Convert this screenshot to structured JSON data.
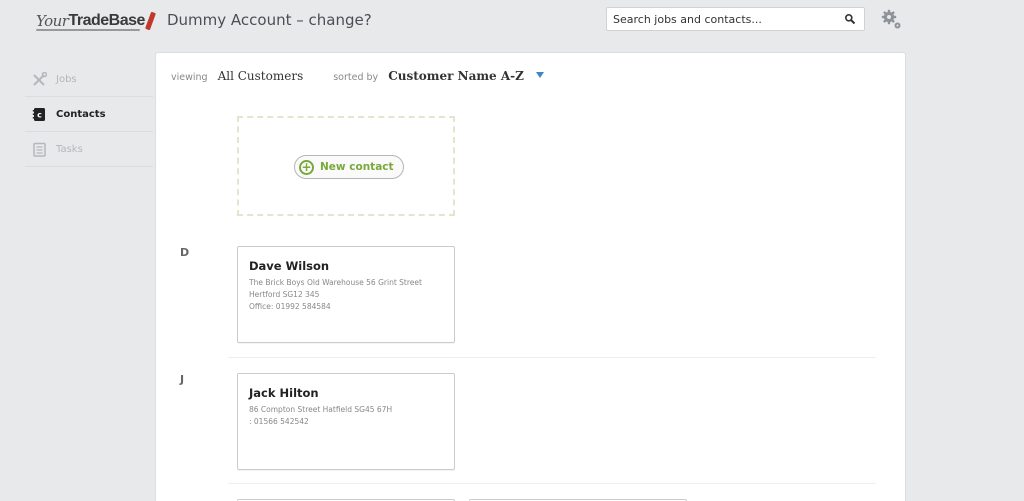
{
  "header": {
    "logo_your": "Your",
    "logo_tradebase": "TradeBase",
    "account_title": "Dummy Account – change?",
    "search_placeholder": "Search jobs and contacts..."
  },
  "sidebar": {
    "items": [
      {
        "label": "Jobs",
        "icon": "tools-icon",
        "active": false
      },
      {
        "label": "Contacts",
        "icon": "contacts-book-icon",
        "active": true
      },
      {
        "label": "Tasks",
        "icon": "tasks-icon",
        "active": false
      }
    ]
  },
  "main": {
    "viewing_label": "viewing",
    "viewing_value": "All Customers",
    "sorted_label": "sorted by",
    "sorted_value": "Customer Name A-Z",
    "new_contact_label": "New contact",
    "groups": [
      {
        "letter": "D",
        "contacts": [
          {
            "name": "Dave Wilson",
            "address": "The Brick Boys Old Warehouse 56 Grint Street",
            "city": "Hertford SG12 345",
            "phone": "Office: 01992 584584"
          }
        ]
      },
      {
        "letter": "J",
        "contacts": [
          {
            "name": "Jack Hilton",
            "address": "86 Compton Street Hatfield SG45 67H",
            "phone": ": 01566 542542"
          }
        ]
      }
    ]
  },
  "colors": {
    "accent_green": "#7aa83a",
    "caret_blue": "#3b87c9",
    "background": "#e8e9eb"
  }
}
